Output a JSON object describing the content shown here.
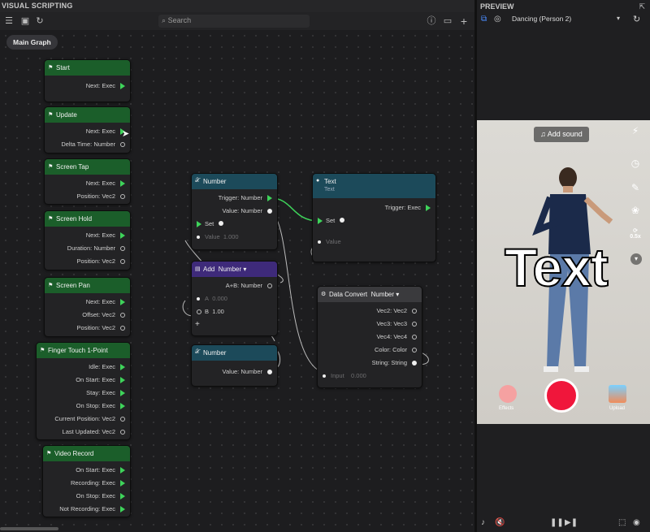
{
  "app": {
    "editor_title": "VISUAL SCRIPTING",
    "preview_title": "PREVIEW"
  },
  "search": {
    "placeholder": "Search"
  },
  "graph_tab": "Main Graph",
  "nodes": {
    "start": {
      "title": "Start",
      "rows": [
        "Next: Exec"
      ]
    },
    "update": {
      "title": "Update",
      "rows": [
        "Next: Exec",
        "Delta Time: Number"
      ]
    },
    "screen_tap": {
      "title": "Screen Tap",
      "rows": [
        "Next: Exec",
        "Position: Vec2"
      ]
    },
    "screen_hold": {
      "title": "Screen Hold",
      "rows": [
        "Next: Exec",
        "Duration: Number",
        "Position: Vec2"
      ]
    },
    "screen_pan": {
      "title": "Screen Pan",
      "rows": [
        "Next: Exec",
        "Offset: Vec2",
        "Position: Vec2"
      ]
    },
    "finger_touch": {
      "title": "Finger Touch 1-Point",
      "rows": [
        "Idle: Exec",
        "On Start: Exec",
        "Stay: Exec",
        "On Stop: Exec",
        "Current Position: Vec2",
        "Last Updated: Vec2"
      ]
    },
    "video_record": {
      "title": "Video Record",
      "rows": [
        "On Start: Exec",
        "Recording: Exec",
        "On Stop: Exec",
        "Not Recording: Exec"
      ]
    },
    "number_set": {
      "title": "Number",
      "trigger": "Trigger: Number",
      "value_out": "Value: Number",
      "set": "Set",
      "value_in": "Value",
      "value_in_val": "1.000"
    },
    "text_set": {
      "title": "Text",
      "subtitle": "Text",
      "trigger": "Trigger: Exec",
      "set": "Set",
      "value_in": "Value"
    },
    "add": {
      "title": "Add",
      "type": "Number",
      "out": "A+B: Number",
      "a_label": "A",
      "a_val": "0.000",
      "b_label": "B",
      "b_val": "1.00",
      "plus": "+"
    },
    "number_get": {
      "title": "Number",
      "value_out": "Value: Number"
    },
    "data_convert": {
      "title": "Data Convert",
      "type": "Number",
      "rows": [
        "Vec2: Vec2",
        "Vec3: Vec3",
        "Vec4: Vec4",
        "Color: Color",
        "String: String"
      ],
      "input": "Input",
      "input_val": "0.000"
    }
  },
  "preview": {
    "selected_person": "Dancing (Person 2)",
    "add_sound": "Add sound",
    "overlay_text": "Text",
    "effects_label": "Effects",
    "upload_label": "Upload",
    "speed": "0.5x"
  }
}
